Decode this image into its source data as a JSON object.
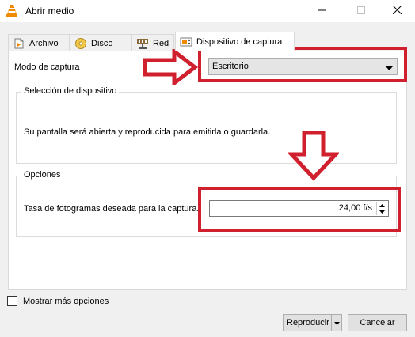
{
  "window": {
    "title": "Abrir medio",
    "minimize_glyph": "—",
    "maximize_glyph": "☐",
    "close_glyph": "✕"
  },
  "tabs": [
    {
      "label": "Archivo",
      "icon": "file-icon",
      "active": false
    },
    {
      "label": "Disco",
      "icon": "disc-icon",
      "active": false
    },
    {
      "label": "Red",
      "icon": "network-icon",
      "active": false
    },
    {
      "label": "Dispositivo de captura",
      "icon": "capture-device-icon",
      "active": true
    }
  ],
  "capture": {
    "mode_label": "Modo de captura",
    "mode_value": "Escritorio"
  },
  "device_group": {
    "title": "Selección de dispositivo",
    "description": "Su pantalla será abierta y reproducida para emitirla o guardarla."
  },
  "options_group": {
    "title": "Opciones",
    "fps_label": "Tasa de fotogramas deseada para la captura.",
    "fps_value": "24,00 f/s"
  },
  "footer": {
    "more_options_label": "Mostrar más opciones",
    "more_options_checked": false,
    "play_label": "Reproducir",
    "cancel_label": "Cancelar"
  },
  "colors": {
    "annotation": "#d0202d",
    "vlc_orange": "#f08a00"
  }
}
